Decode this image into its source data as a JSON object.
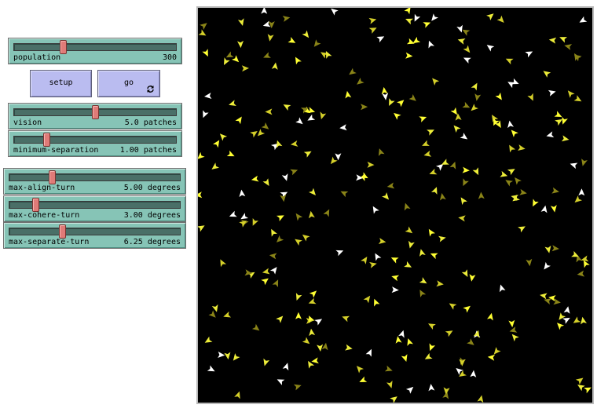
{
  "sliders": [
    {
      "id": "population",
      "label": "population",
      "value": "300",
      "fraction": 0.3
    },
    {
      "id": "vision",
      "label": "vision",
      "value": "5.0 patches",
      "fraction": 0.5
    },
    {
      "id": "minimum-separation",
      "label": "minimum-separation",
      "value": "1.00 patches",
      "fraction": 0.2
    },
    {
      "id": "max-align-turn",
      "label": "max-align-turn",
      "value": "5.00 degrees",
      "fraction": 0.25
    },
    {
      "id": "max-cohere-turn",
      "label": "max-cohere-turn",
      "value": "3.00 degrees",
      "fraction": 0.15
    },
    {
      "id": "max-separate-turn",
      "label": "max-separate-turn",
      "value": "6.25 degrees",
      "fraction": 0.31
    }
  ],
  "buttons": {
    "setup_label": "setup",
    "go_label": "go",
    "go_icon": "forever-loop-icon"
  },
  "world": {
    "background": "#000000",
    "agent_count": 300,
    "agent_colors": [
      "#ffff33",
      "#ffffff",
      "#d4cf2a",
      "#8a8418",
      "#eded3a"
    ]
  },
  "colors": {
    "slider_bg": "#86c4b6",
    "slider_knob": "#e07b78",
    "button_bg": "#babcf0"
  }
}
